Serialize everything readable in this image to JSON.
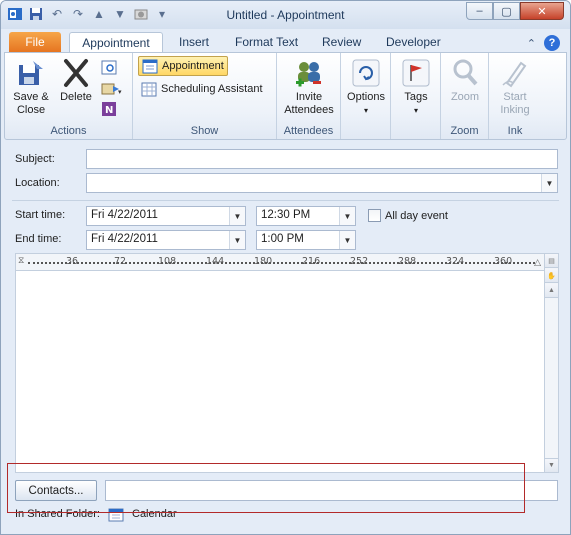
{
  "window": {
    "title": "Untitled  -  Appointment",
    "minimize": "–",
    "restore": "▢",
    "close": "✕"
  },
  "quick_access": [
    "save-icon",
    "undo-icon",
    "redo-icon",
    "up-icon",
    "down-icon",
    "customize-icon",
    "dropdown-icon"
  ],
  "tabs": [
    {
      "label": "File"
    },
    {
      "label": "Appointment"
    },
    {
      "label": "Insert"
    },
    {
      "label": "Format Text"
    },
    {
      "label": "Review"
    },
    {
      "label": "Developer"
    }
  ],
  "ribbon": {
    "actions": {
      "label": "Actions",
      "save_close": "Save &\nClose",
      "delete": "Delete"
    },
    "show": {
      "label": "Show",
      "appointment": "Appointment",
      "scheduling_assistant": "Scheduling Assistant"
    },
    "attendees": {
      "label": "Attendees",
      "invite": "Invite\nAttendees"
    },
    "options": {
      "label": "Options"
    },
    "tags": {
      "label": "Tags"
    },
    "zoom": {
      "label": "Zoom",
      "button": "Zoom"
    },
    "ink": {
      "label": "Ink",
      "button": "Start\nInking"
    }
  },
  "form": {
    "subject_label": "Subject:",
    "subject_value": "",
    "location_label": "Location:",
    "location_value": "",
    "start_label": "Start time:",
    "start_date": "Fri 4/22/2011",
    "start_time": "12:30 PM",
    "all_day_label": "All day event",
    "all_day_checked": false,
    "end_label": "End time:",
    "end_date": "Fri 4/22/2011",
    "end_time": "1:00 PM"
  },
  "ruler": [
    "36",
    "72",
    "108",
    "144",
    "180",
    "216",
    "252",
    "288",
    "324",
    "360"
  ],
  "footer": {
    "contacts_button": "Contacts...",
    "contacts_value": "",
    "shared_folder_label": "In Shared Folder:",
    "folder_name": "Calendar"
  },
  "colors": {
    "file_tab": "#e5721f",
    "selected_button": "#ffd765",
    "highlight": "#b22a2a"
  }
}
